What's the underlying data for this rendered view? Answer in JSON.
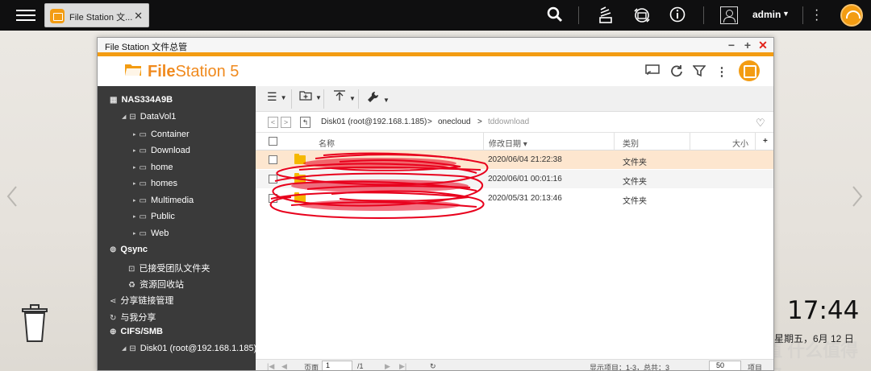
{
  "taskbar": {
    "tab_label": "File Station 文...",
    "tab_close": "✕",
    "user": "admin"
  },
  "window": {
    "title": "File Station 文件总管",
    "app_name_bold": "File",
    "app_name_rest": "Station 5"
  },
  "sidebar": {
    "root": "NAS334A9B",
    "volume": "DataVol1",
    "folders": [
      "Container",
      "Download",
      "home",
      "homes",
      "Multimedia",
      "Public",
      "Web"
    ],
    "qsync": "Qsync",
    "qsync_items": [
      "已接受团队文件夹",
      "资源回收站"
    ],
    "share_link": "分享链接管理",
    "shared_with_me": "与我分享",
    "cifs": "CIFS/SMB",
    "cifs_item": "Disk01 (root@192.168.1.185)"
  },
  "path": {
    "segments": [
      "Disk01 (root@192.168.1.185)",
      "onecloud",
      "tddownload"
    ],
    "separator": ">"
  },
  "table": {
    "headers": {
      "name": "名称",
      "modified": "修改日期",
      "type": "类别",
      "size": "大小",
      "add": "+"
    },
    "rows": [
      {
        "modified": "2020/06/04 21:22:38",
        "type": "文件夹"
      },
      {
        "modified": "2020/06/01 00:01:16",
        "type": "文件夹"
      },
      {
        "modified": "2020/05/31 20:13:46",
        "type": "文件夹"
      }
    ]
  },
  "footer": {
    "page_label": "页面",
    "page_value": "1",
    "page_total": "/1",
    "showing": "显示项目：1-3，总共：3",
    "per_page": "50",
    "items_label": "项目"
  },
  "desktop": {
    "time": "17:44",
    "date": "星期五，6月 12 日",
    "watermark": "值 什么值得买"
  },
  "colors": {
    "accent": "#f39c12",
    "sidebar_bg": "#3a3a3a",
    "selected_row": "#fde6cf",
    "redaction": "#e8001c"
  }
}
